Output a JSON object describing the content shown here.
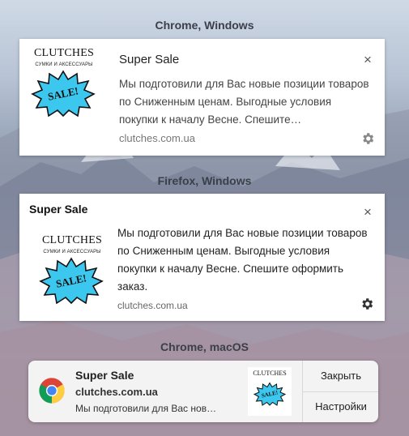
{
  "sections": {
    "chrome_windows": "Chrome, Windows",
    "firefox_windows": "Firefox, Windows",
    "chrome_macos": "Chrome, macOS"
  },
  "logo": {
    "brand": "CLUTCHES",
    "tagline": "СУМКИ И АКСЕССУАРЫ",
    "badge": "SALE!",
    "badge_color": "#3cc8ee"
  },
  "chrome_windows": {
    "title": "Super Sale",
    "body": "Мы подготовили для Вас новые позиции товаров по Сниженным ценам. Выгодные условия покупки к началу Весне. Спешите…",
    "domain": "clutches.com.ua",
    "close": "×"
  },
  "firefox_windows": {
    "title": "Super Sale",
    "body": "Мы подготовили для Вас новые позиции товаров по Сниженным ценам. Выгодные условия покупки к началу Весне. Спешите оформить заказ.",
    "domain": "clutches.com.ua",
    "close": "×"
  },
  "chrome_macos": {
    "title": "Super Sale",
    "domain": "clutches.com.ua",
    "body": "Мы подготовили для Вас нов…",
    "close_button": "Закрыть",
    "settings_button": "Настройки"
  }
}
